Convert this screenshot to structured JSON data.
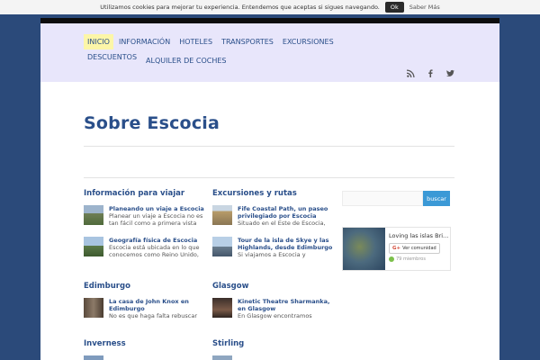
{
  "cookie": {
    "text": "Utilizamos cookies para mejorar tu experiencia. Entendemos que aceptas si sigues navegando.",
    "ok_label": "Ok",
    "more_label": "Saber Más"
  },
  "nav": {
    "items": [
      "INICIO",
      "INFORMACIÓN",
      "HOTELES",
      "TRANSPORTES",
      "EXCURSIONES",
      "DESCUENTOS",
      "ALQUILER DE COCHES"
    ],
    "active": "INICIO"
  },
  "social": [
    "rss-icon",
    "facebook-icon",
    "twitter-icon"
  ],
  "page": {
    "title": "Sobre Escocia"
  },
  "sections": [
    {
      "title": "Información para viajar",
      "posts": [
        {
          "title": "Planeando un viaje a Escocia",
          "excerpt": "Planear un viaje a Escocia no es tan fácil como a primera vista"
        },
        {
          "title": "Geografía física de Escocia",
          "excerpt": "Escocia está ubicada en lo que conocemos como Reino Unido,"
        }
      ]
    },
    {
      "title": "Excursiones y rutas",
      "posts": [
        {
          "title": "Fife Coastal Path, un paseo privilegiado por Escocia",
          "excerpt": "Situado en el Este de Escocia,"
        },
        {
          "title": "Tour de la isla de Skye y las Highlands, desde Edimburgo",
          "excerpt": "Si viajamos a Escocia y"
        }
      ]
    },
    {
      "title": "Edimburgo",
      "posts": [
        {
          "title": "La casa de John Knox en Edimburgo",
          "excerpt": "No es que haga falta rebuscar"
        }
      ]
    },
    {
      "title": "Glasgow",
      "posts": [
        {
          "title": "Kinetic Theatre Sharmanka, en Glasgow",
          "excerpt": "En Glasgow encontramos"
        }
      ]
    },
    {
      "title": "Inverness",
      "posts": []
    },
    {
      "title": "Stirling",
      "posts": []
    }
  ],
  "sidebar": {
    "search_button": "buscar",
    "widget": {
      "title": "Loving las islas Bri...",
      "follow_label": "Ver comunidad",
      "members": "79 miembros"
    }
  },
  "colors": {
    "background": "#2b4a7a",
    "header": "#e8e6fb",
    "link": "#2a4f8a",
    "active_nav": "#fcf6a8",
    "search_button": "#3b99d6"
  }
}
